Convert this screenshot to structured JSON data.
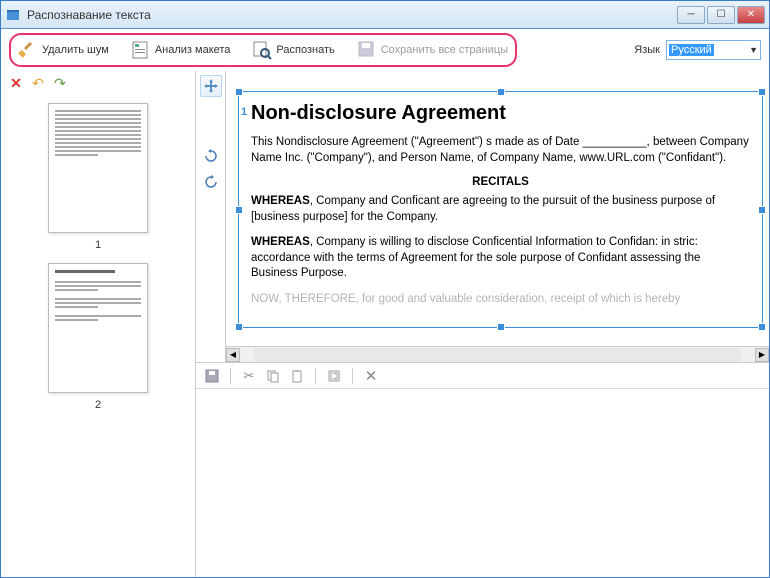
{
  "window": {
    "title": "Распознавание текста"
  },
  "toolbar": {
    "remove_noise": "Удалить шум",
    "analyze_layout": "Анализ макета",
    "recognize": "Распознать",
    "save_all": "Сохранить все страницы",
    "language_label": "Язык",
    "language_value": "Русский"
  },
  "thumbnails": {
    "page1_num": "1",
    "page2_num": "2"
  },
  "document": {
    "region_number": "1",
    "title": "Non-disclosure Agreement",
    "para1": "This Nondisclosure Agreement (\"Agreement\")  s made as of Date __________, between Company Name Inc. (\"Company\"), and Person Name, of Company Name, www.URL.com (\"Confidant\").",
    "recitals_heading": "RECITALS",
    "para2_label": "WHEREAS",
    "para2": ", Company and Conficant are agreeing to the pursuit of the business purpose of [business purpose] for the Company.",
    "para3_label": "WHEREAS",
    "para3": ", Company is willing to disclose Conficential Information to Confidan: in stric: accordance with the terms of Agreement for the sole purpose of Confidant assessing the Business Purpose.",
    "para4": "NOW, THEREFORE, for good and valuable consideration, receipt of which is hereby"
  }
}
